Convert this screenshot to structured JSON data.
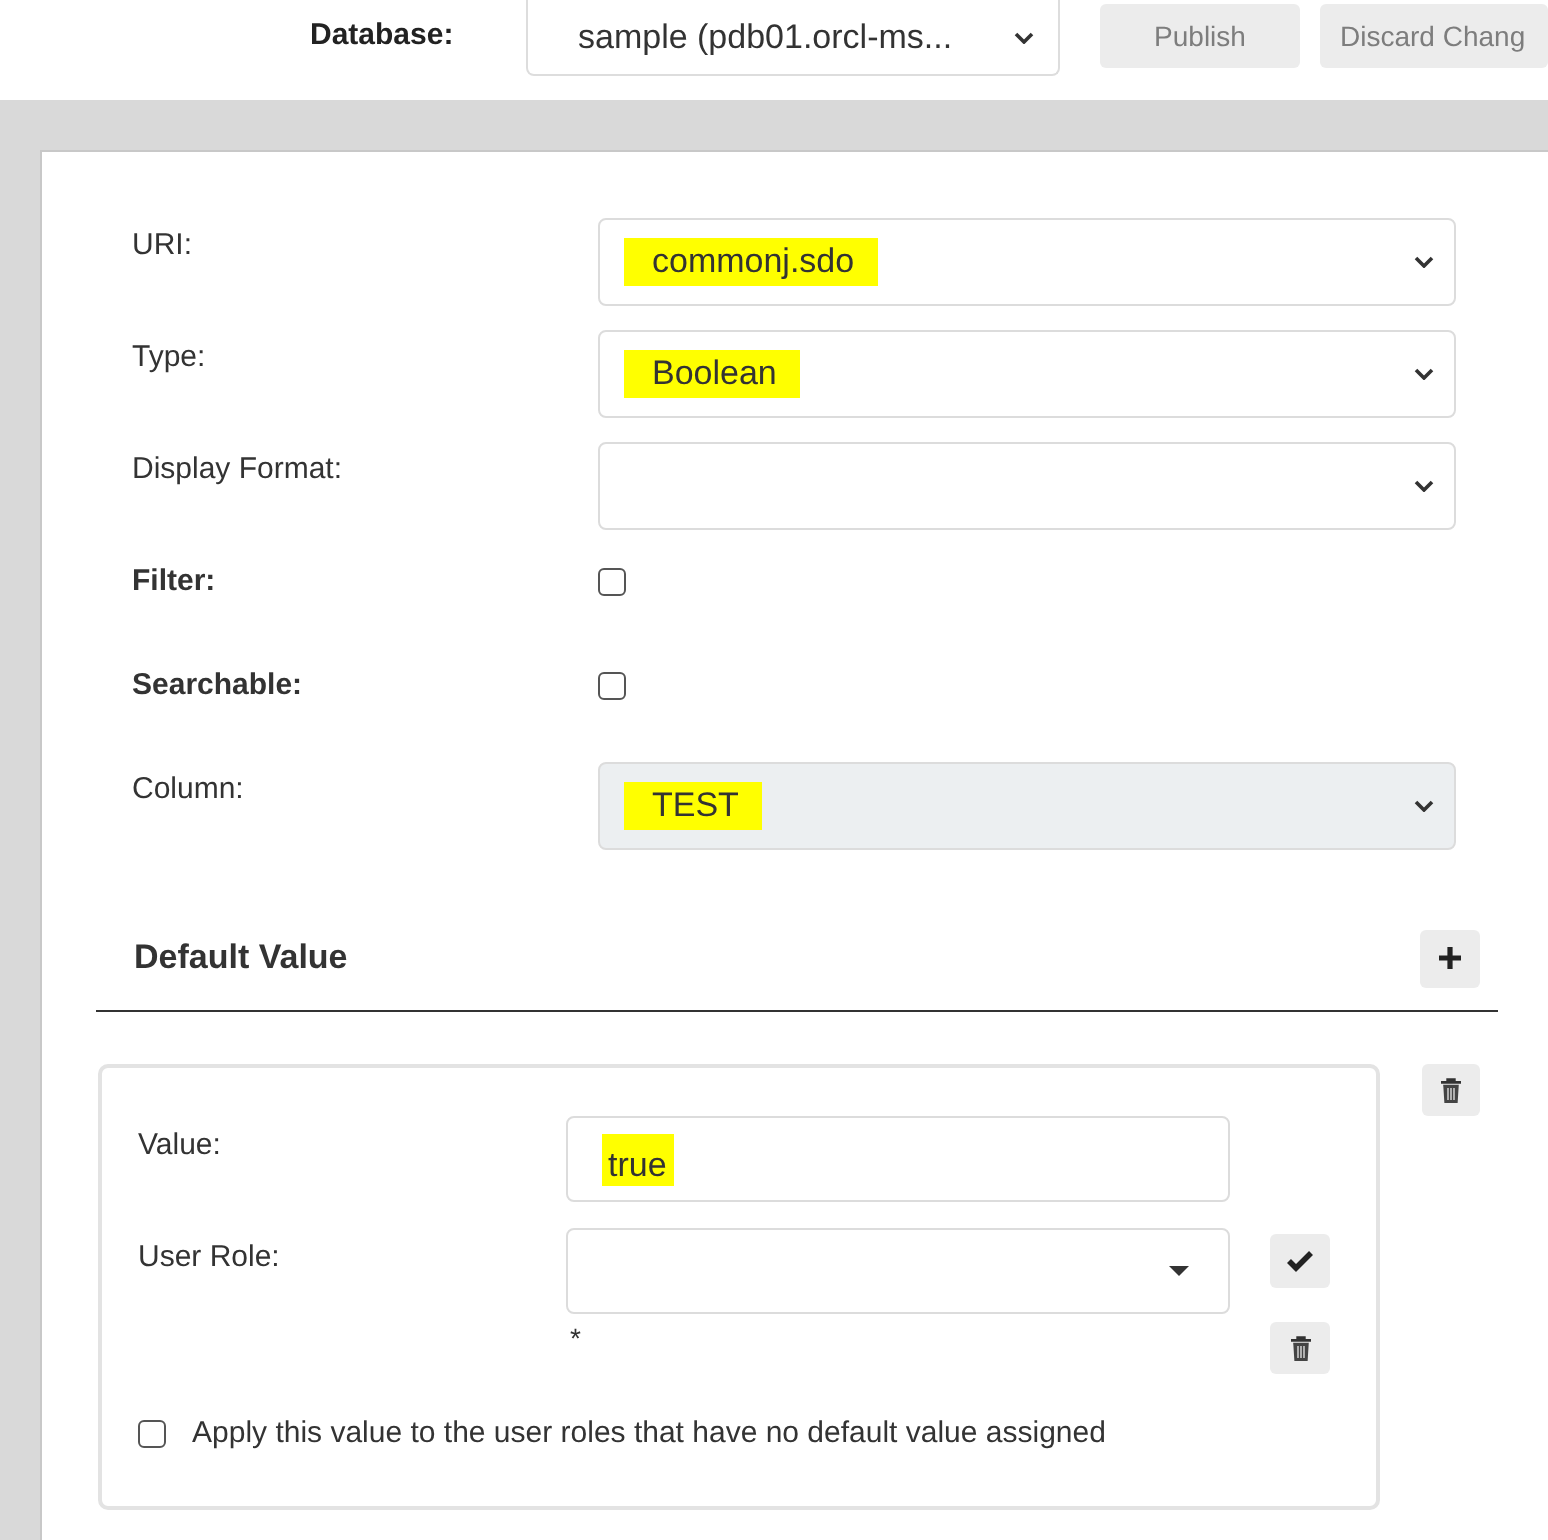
{
  "topbar": {
    "database": {
      "label": "Database:",
      "value": "sample (pdb01.orcl-ms..."
    },
    "buttons": [
      {
        "label": "Publish",
        "disabled": true
      },
      {
        "label": "Discard Chang",
        "disabled": true
      }
    ]
  },
  "form": {
    "fields": [
      {
        "kind": "select",
        "label": "URI:",
        "value": "commonj.sdo",
        "highlighted": true,
        "disabled": false
      },
      {
        "kind": "select",
        "label": "Type:",
        "value": "Boolean",
        "highlighted": true,
        "disabled": false
      },
      {
        "kind": "select",
        "label": "Display Format:",
        "disabled": false
      },
      {
        "kind": "checkbox",
        "label": "Filter:",
        "checked": false
      },
      {
        "kind": "checkbox",
        "label": "Searchable:",
        "checked": false
      },
      {
        "kind": "select",
        "label": "Column:",
        "value": "TEST",
        "highlighted": true,
        "disabled": true
      }
    ]
  },
  "default_value": {
    "title": "Default Value",
    "entries": [
      {
        "value_label": "Value:",
        "value": "true",
        "value_highlighted": true,
        "user_role_label": "User Role:",
        "required_mark": "*",
        "apply_to_unassigned": {
          "label": "Apply this value to the user roles that have no default value assigned",
          "checked": false
        }
      }
    ]
  }
}
